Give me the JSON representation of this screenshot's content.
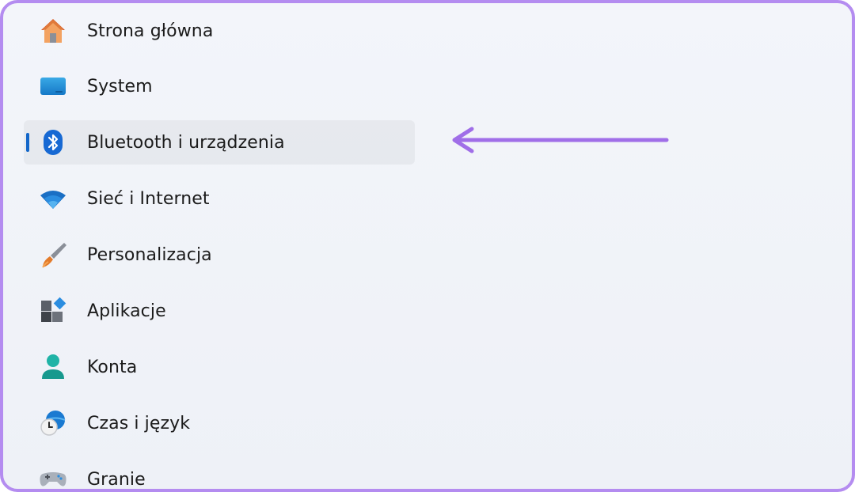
{
  "nav": {
    "items": [
      {
        "label": "Strona główna",
        "icon": "home-icon"
      },
      {
        "label": "System",
        "icon": "monitor-icon"
      },
      {
        "label": "Bluetooth i urządzenia",
        "icon": "bluetooth-icon",
        "selected": true
      },
      {
        "label": "Sieć i Internet",
        "icon": "wifi-icon"
      },
      {
        "label": "Personalizacja",
        "icon": "paintbrush-icon"
      },
      {
        "label": "Aplikacje",
        "icon": "apps-icon"
      },
      {
        "label": "Konta",
        "icon": "person-icon"
      },
      {
        "label": "Czas i język",
        "icon": "clock-globe-icon"
      },
      {
        "label": "Granie",
        "icon": "gamepad-icon"
      }
    ]
  },
  "colors": {
    "accent": "#1366c9",
    "annotation_arrow": "#a06ee8",
    "frame_border": "#b48cf0"
  }
}
